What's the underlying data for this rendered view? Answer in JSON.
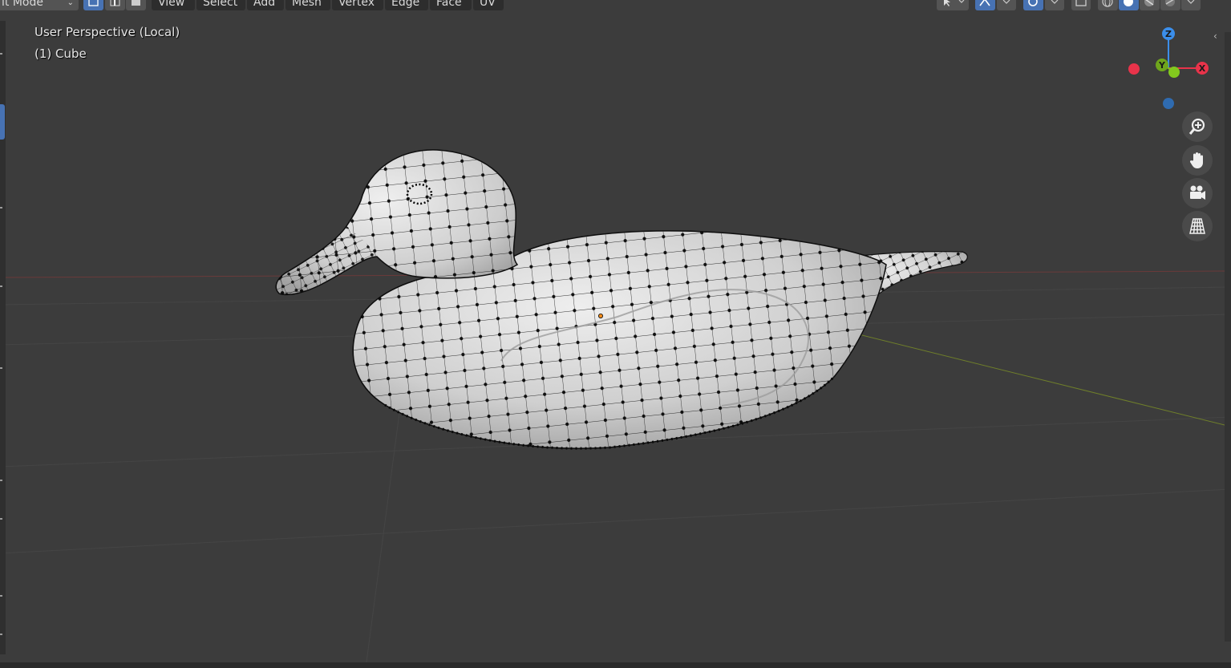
{
  "header": {
    "mode_label": "it Mode",
    "menus": [
      "View",
      "Select",
      "Add",
      "Mesh",
      "Vertex",
      "Edge",
      "Face",
      "UV"
    ]
  },
  "viewport": {
    "perspective_label": "User Perspective (Local)",
    "object_label": "(1) Cube"
  },
  "gizmo": {
    "z_label": "Z",
    "y_label": "Y",
    "x_label": "X",
    "x_color": "#e8334a",
    "y_color": "#82c91e",
    "z_color": "#3b8eea"
  },
  "nav_buttons": [
    {
      "name": "zoom",
      "icon": "zoom-in-icon"
    },
    {
      "name": "pan",
      "icon": "hand-icon"
    },
    {
      "name": "camera",
      "icon": "camera-icon"
    },
    {
      "name": "perspective",
      "icon": "grid-icon"
    }
  ],
  "colors": {
    "background": "#3c3c3c",
    "header_button": "#545454",
    "active_blue": "#4772b3",
    "mesh_surface": "#d0d0d0"
  }
}
